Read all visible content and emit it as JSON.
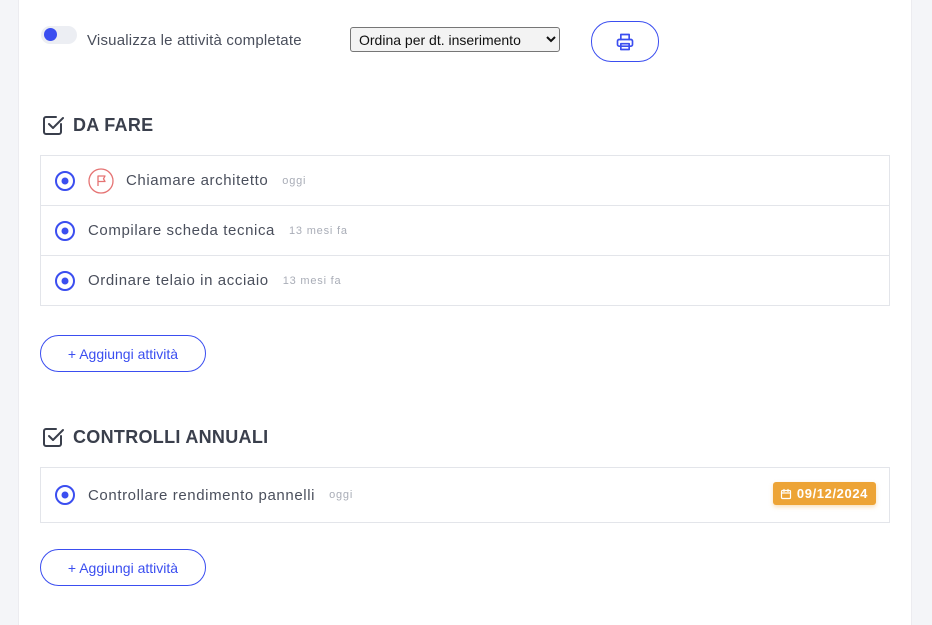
{
  "toolbar": {
    "toggle_label": "Visualizza le attività completate",
    "sort_selected": "Ordina per dt. inserimento",
    "print_icon": "printer-icon"
  },
  "sections": [
    {
      "title": "DA FARE",
      "icon": "checkbox-checked-icon",
      "tasks": [
        {
          "text": "Chiamare architetto",
          "time": "oggi",
          "flag": true
        },
        {
          "text": "Compilare scheda tecnica",
          "time": "13 mesi fa"
        },
        {
          "text": "Ordinare telaio in acciaio",
          "time": "13 mesi fa"
        }
      ],
      "add_label": "+ Aggiungi attività"
    },
    {
      "title": "CONTROLLI ANNUALI",
      "icon": "checkbox-checked-icon",
      "tasks": [
        {
          "text": "Controllare rendimento pannelli",
          "time": "oggi",
          "due_date": "09/12/2024"
        }
      ],
      "add_label": "+ Aggiungi attività"
    }
  ],
  "colors": {
    "accent": "#3b4ef0",
    "flag": "#e57373",
    "due_badge": "#eda436"
  }
}
